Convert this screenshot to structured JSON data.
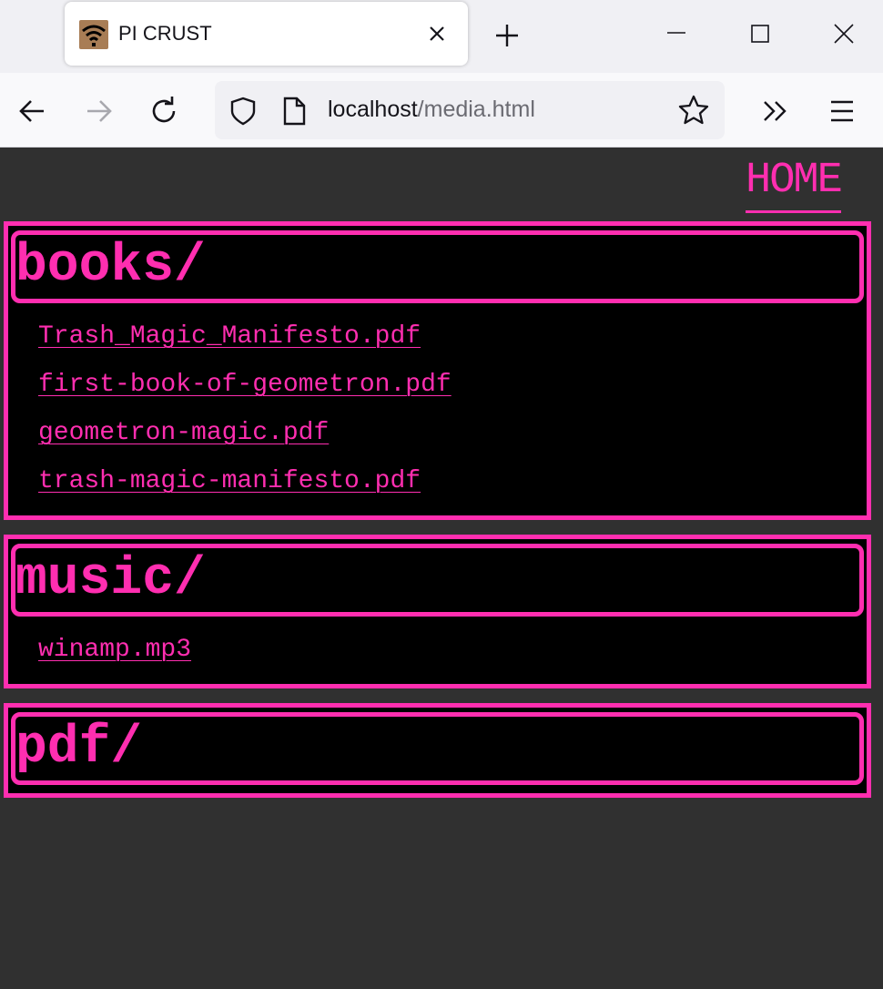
{
  "browser": {
    "tab_title": "PI CRUST",
    "url_host": "localhost",
    "url_path": "/media.html"
  },
  "colors": {
    "accent": "#ff2eb0",
    "page_bg": "#303030",
    "panel_bg": "#000000"
  },
  "nav": {
    "home_label": "HOME"
  },
  "directories": [
    {
      "name": "books/",
      "files": [
        "Trash_Magic_Manifesto.pdf",
        "first-book-of-geometron.pdf",
        "geometron-magic.pdf",
        "trash-magic-manifesto.pdf"
      ]
    },
    {
      "name": "music/",
      "files": [
        "winamp.mp3"
      ]
    },
    {
      "name": "pdf/",
      "files": []
    }
  ]
}
